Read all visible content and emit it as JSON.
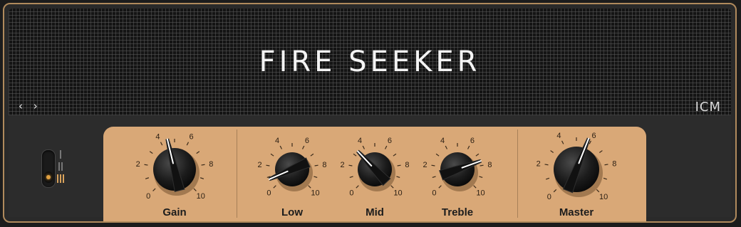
{
  "header": {
    "title": "FIRE SEEKER",
    "nav_prev": "‹",
    "nav_next": "›",
    "logo": "ICM"
  },
  "channel_switch": {
    "levels": [
      "I",
      "II",
      "III"
    ],
    "selected_level": 3
  },
  "knobs": [
    {
      "id": "gain",
      "label": "Gain",
      "value": 4.5,
      "scale": [
        "0",
        "2",
        "4",
        "6",
        "8",
        "10"
      ]
    },
    {
      "id": "low",
      "label": "Low",
      "value": 0.8,
      "scale": [
        "0",
        "2",
        "4",
        "6",
        "8",
        "10"
      ]
    },
    {
      "id": "mid",
      "label": "Mid",
      "value": 3.4,
      "scale": [
        "0",
        "2",
        "4",
        "6",
        "8",
        "10"
      ]
    },
    {
      "id": "treble",
      "label": "Treble",
      "value": 7.6,
      "scale": [
        "0",
        "2",
        "4",
        "6",
        "8",
        "10"
      ]
    },
    {
      "id": "master",
      "label": "Master",
      "value": 5.8,
      "scale": [
        "0",
        "2",
        "4",
        "6",
        "8",
        "10"
      ]
    }
  ],
  "colors": {
    "panel": "#d9a877",
    "frame_border": "#b08a5c",
    "grille": "#141414",
    "indicator": "#ffffff",
    "label": "#1c1c1c"
  }
}
